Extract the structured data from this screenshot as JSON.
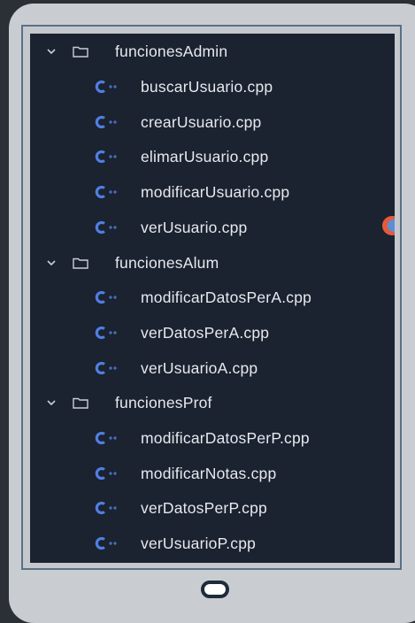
{
  "explorer": {
    "groups": [
      {
        "folder": "funcionesAdmin",
        "files": [
          "buscarUsuario.cpp",
          "crearUsuario.cpp",
          "elimarUsuario.cpp",
          "modificarUsuario.cpp",
          "verUsuario.cpp"
        ]
      },
      {
        "folder": "funcionesAlum",
        "files": [
          "modificarDatosPerA.cpp",
          "verDatosPerA.cpp",
          "verUsuarioA.cpp"
        ]
      },
      {
        "folder": "funcionesProf",
        "files": [
          "modificarDatosPerP.cpp",
          "modificarNotas.cpp",
          "verDatosPerP.cpp",
          "verUsuarioP.cpp"
        ]
      }
    ]
  },
  "icons": {
    "folder": "folder-icon",
    "chevron": "chevron-down-icon",
    "file": "cpp-file-icon"
  },
  "colors": {
    "panel_bg": "#1b2230",
    "text": "#e6e9ee",
    "cpp_icon": "#4f7fe0",
    "device_bezel": "#c9cdd2"
  }
}
